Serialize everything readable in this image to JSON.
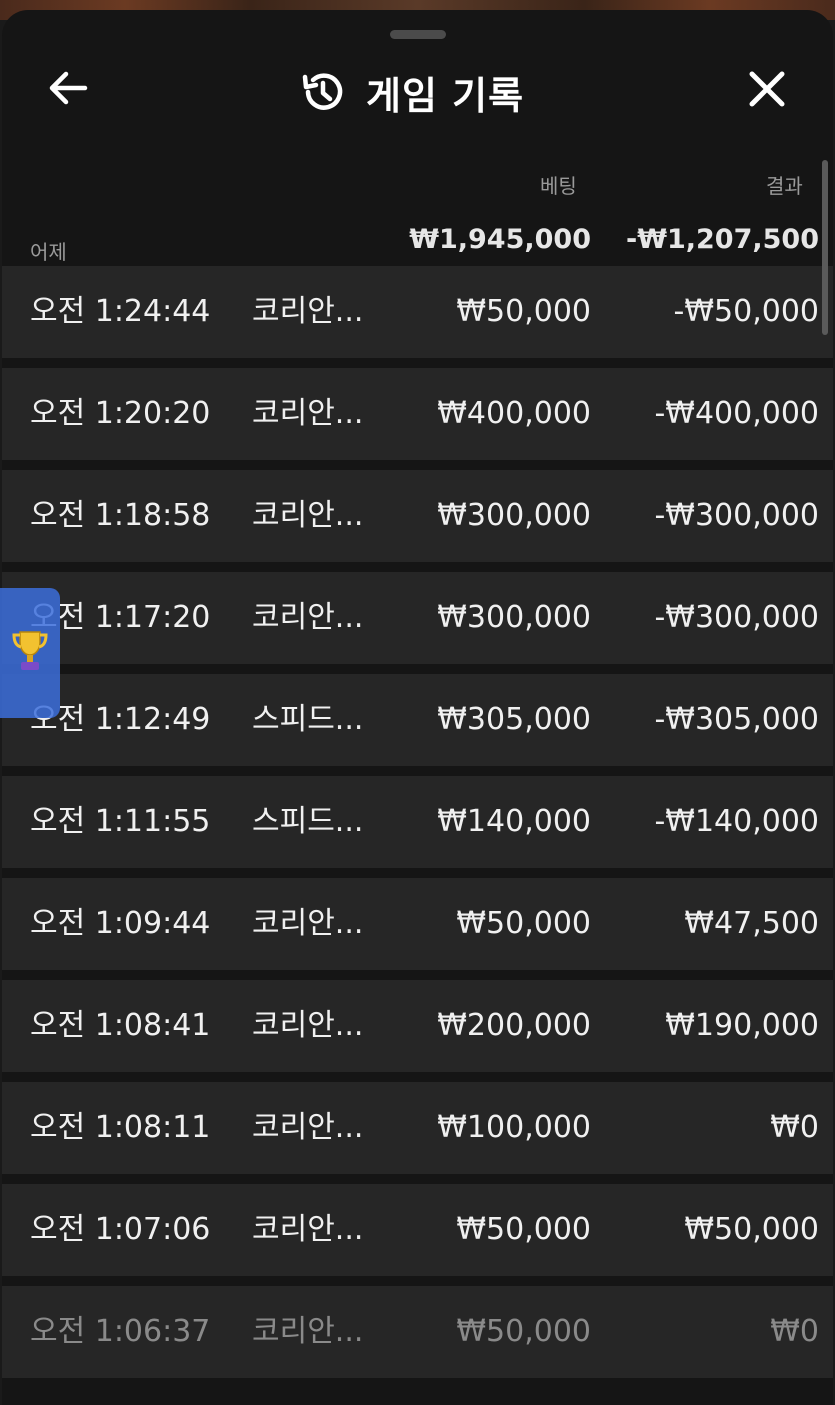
{
  "header": {
    "title": "게임 기록"
  },
  "columns": {
    "bet_label": "베팅",
    "result_label": "결과"
  },
  "summary": {
    "date_label": "어제",
    "total_bet": "₩1,945,000",
    "total_result": "-₩1,207,500"
  },
  "rows": [
    {
      "time": "오전 1:24:44",
      "game": "코리안...",
      "bet": "₩50,000",
      "result": "-₩50,000"
    },
    {
      "time": "오전 1:20:20",
      "game": "코리안...",
      "bet": "₩400,000",
      "result": "-₩400,000"
    },
    {
      "time": "오전 1:18:58",
      "game": "코리안...",
      "bet": "₩300,000",
      "result": "-₩300,000"
    },
    {
      "time": "오전 1:17:20",
      "game": "코리안...",
      "bet": "₩300,000",
      "result": "-₩300,000"
    },
    {
      "time": "오전 1:12:49",
      "game": "스피드...",
      "bet": "₩305,000",
      "result": "-₩305,000"
    },
    {
      "time": "오전 1:11:55",
      "game": "스피드...",
      "bet": "₩140,000",
      "result": "-₩140,000"
    },
    {
      "time": "오전 1:09:44",
      "game": "코리안...",
      "bet": "₩50,000",
      "result": "₩47,500"
    },
    {
      "time": "오전 1:08:41",
      "game": "코리안...",
      "bet": "₩200,000",
      "result": "₩190,000"
    },
    {
      "time": "오전 1:08:11",
      "game": "코리안...",
      "bet": "₩100,000",
      "result": "₩0"
    },
    {
      "time": "오전 1:07:06",
      "game": "코리안...",
      "bet": "₩50,000",
      "result": "₩50,000"
    },
    {
      "time": "오전 1:06:37",
      "game": "코리안...",
      "bet": "₩50,000",
      "result": "₩0"
    }
  ],
  "icons": {
    "back": "arrow-left-icon",
    "history": "history-icon",
    "close": "close-icon",
    "trophy": "trophy-icon"
  },
  "colors": {
    "sheet_bg": "#151515",
    "row_bg": "#262626",
    "text": "#f0f0f0",
    "muted": "#9a9a9a",
    "trophy_tab": "#3c6edc"
  }
}
